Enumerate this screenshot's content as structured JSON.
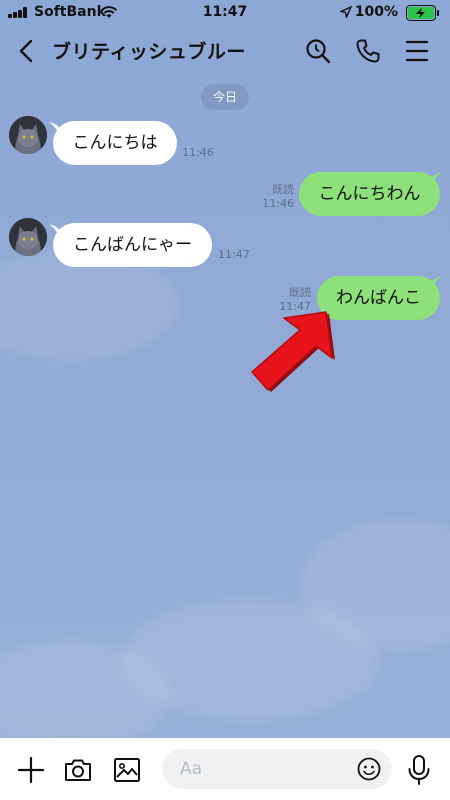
{
  "status_bar": {
    "carrier": "SoftBank",
    "time": "11:47",
    "battery": "100%"
  },
  "header": {
    "title": "ブリティッシュブルー"
  },
  "date_divider": "今日",
  "messages": [
    {
      "direction": "incoming",
      "text": "こんにちは",
      "time": "11:46"
    },
    {
      "direction": "outgoing",
      "text": "こんにちわん",
      "read": "既読",
      "time": "11:46"
    },
    {
      "direction": "incoming",
      "text": "こんばんにゃー",
      "time": "11:47"
    },
    {
      "direction": "outgoing",
      "text": "わんばんこ",
      "read": "既読",
      "time": "11:47"
    }
  ],
  "input": {
    "placeholder": "Aa"
  },
  "colors": {
    "background": "#8fa7d3",
    "incoming_bubble": "#ffffff",
    "outgoing_bubble": "#8de07a",
    "arrow": "#e8141b"
  },
  "icons": {
    "header": [
      "back-icon",
      "search-icon",
      "phone-icon",
      "menu-icon"
    ],
    "input_bar": [
      "plus-icon",
      "camera-icon",
      "image-icon",
      "emoji-icon",
      "mic-icon"
    ]
  }
}
